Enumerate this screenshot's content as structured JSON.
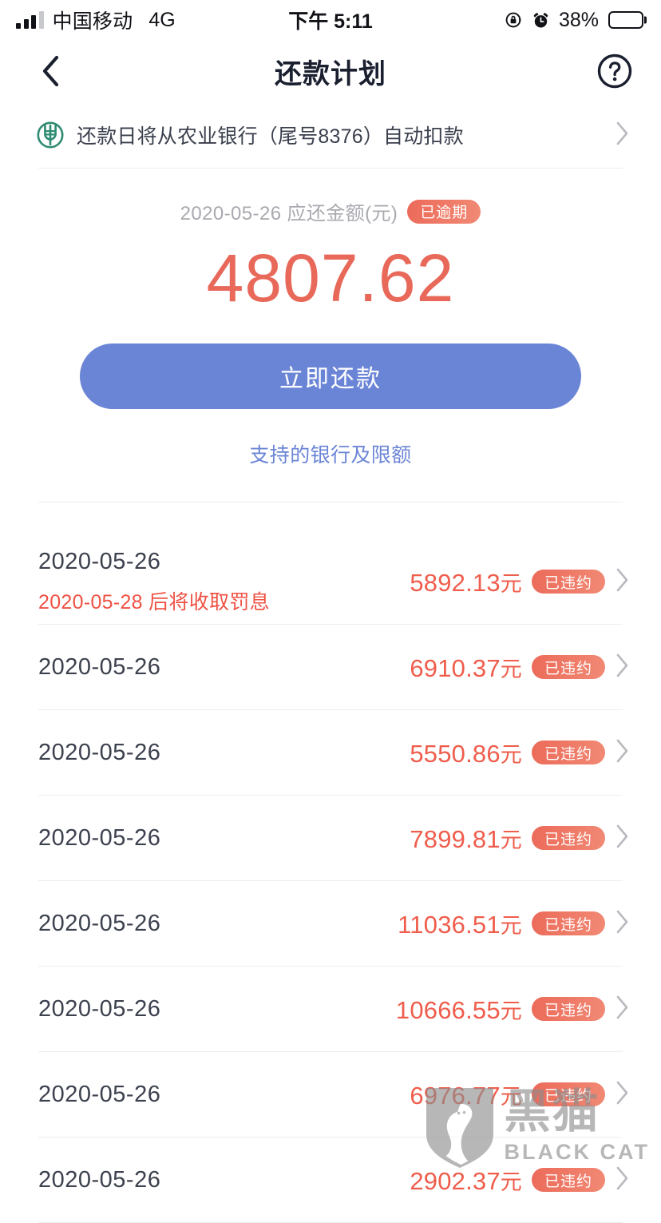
{
  "status_bar": {
    "carrier": "中国移动",
    "network": "4G",
    "time": "下午 5:11",
    "battery_percent": "38%",
    "battery_level": 38,
    "signal_bars_filled": 3,
    "signal_bars_total": 4,
    "icons": {
      "rotation_lock": "rotation-lock-icon",
      "alarm": "alarm-clock-icon",
      "battery": "battery-icon"
    }
  },
  "nav": {
    "title": "还款计划",
    "back_icon": "chevron-left-icon",
    "help_icon": "question-mark-circle-icon"
  },
  "bank": {
    "icon": "abc-bank-logo-icon",
    "text": "还款日将从农业银行（尾号8376）自动扣款",
    "chevron_icon": "chevron-right-icon"
  },
  "summary": {
    "label": "2020-05-26 应还金额(元)",
    "badge": "已逾期",
    "amount": "4807.62"
  },
  "cta": {
    "repay_label": "立即还款",
    "support_link": "支持的银行及限额"
  },
  "colors": {
    "accent_blue": "#6b85d6",
    "amount_red": "#e8685a",
    "badge_gradient_from": "#ec6a59",
    "badge_gradient_to": "#f18a75",
    "note_red": "#ef5244",
    "divider": "#eeeef1",
    "bank_green": "#2e8b72"
  },
  "plan_list": [
    {
      "date": "2020-05-26",
      "note": "2020-05-28 后将收取罚息",
      "amount": "5892.13",
      "unit": "元",
      "badge": "已违约",
      "chevron_icon": "chevron-right-icon"
    },
    {
      "date": "2020-05-26",
      "note": "",
      "amount": "6910.37",
      "unit": "元",
      "badge": "已违约",
      "chevron_icon": "chevron-right-icon"
    },
    {
      "date": "2020-05-26",
      "note": "",
      "amount": "5550.86",
      "unit": "元",
      "badge": "已违约",
      "chevron_icon": "chevron-right-icon"
    },
    {
      "date": "2020-05-26",
      "note": "",
      "amount": "7899.81",
      "unit": "元",
      "badge": "已违约",
      "chevron_icon": "chevron-right-icon"
    },
    {
      "date": "2020-05-26",
      "note": "",
      "amount": "11036.51",
      "unit": "元",
      "badge": "已违约",
      "chevron_icon": "chevron-right-icon"
    },
    {
      "date": "2020-05-26",
      "note": "",
      "amount": "10666.55",
      "unit": "元",
      "badge": "已违约",
      "chevron_icon": "chevron-right-icon"
    },
    {
      "date": "2020-05-26",
      "note": "",
      "amount": "6976.77",
      "unit": "元",
      "badge": "已违约",
      "chevron_icon": "chevron-right-icon"
    },
    {
      "date": "2020-05-26",
      "note": "",
      "amount": "2902.37",
      "unit": "元",
      "badge": "已违约",
      "chevron_icon": "chevron-right-icon"
    }
  ],
  "watermark": {
    "cn": "黑猫",
    "en": "BLACK CAT",
    "icon": "cat-shield-icon"
  }
}
